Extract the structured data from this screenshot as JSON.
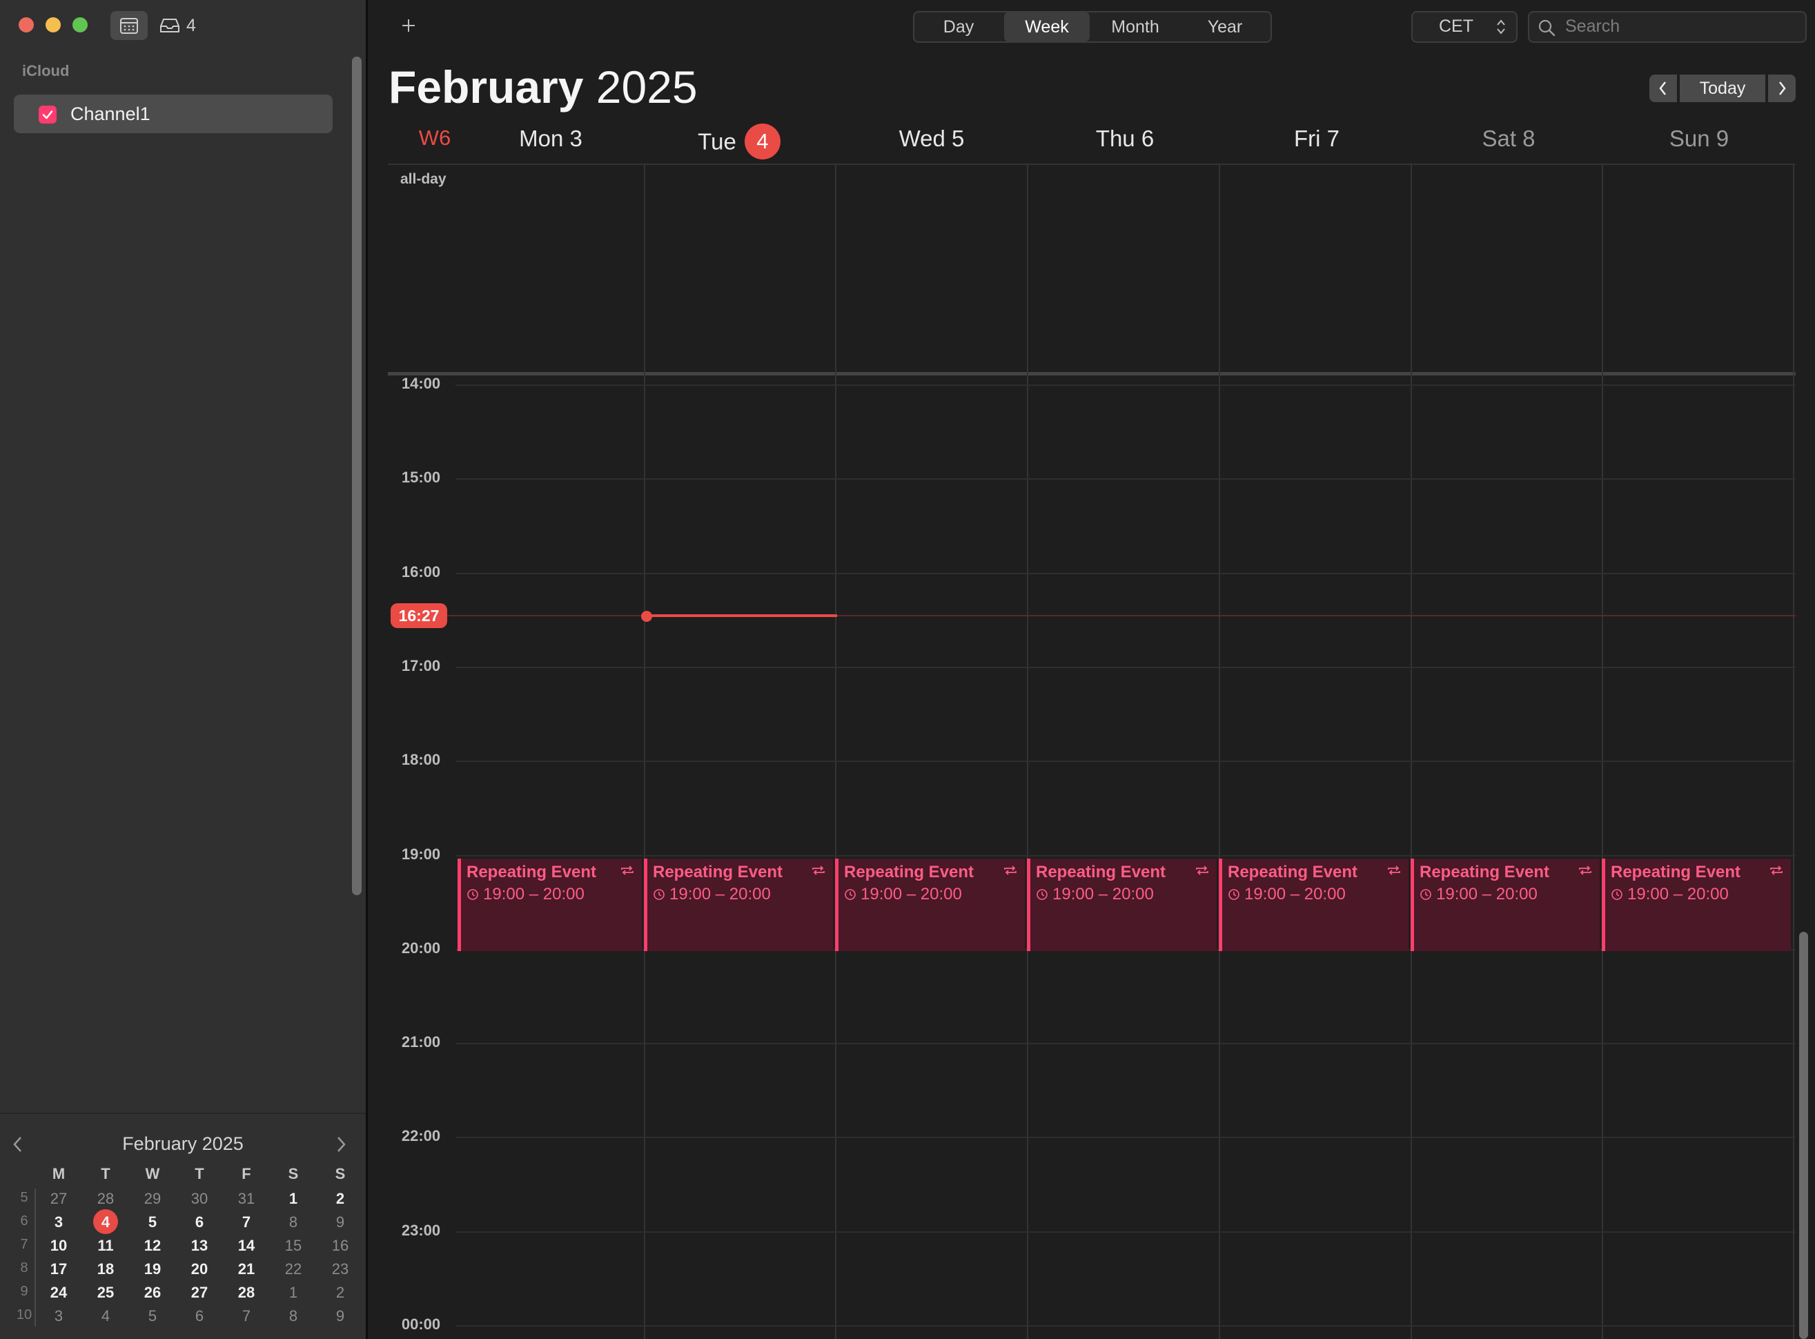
{
  "toolbar": {
    "inbox_count": "4",
    "views": [
      "Day",
      "Week",
      "Month",
      "Year"
    ],
    "active_view": "Week",
    "timezone": "CET",
    "search_placeholder": "Search",
    "today_label": "Today"
  },
  "sidebar": {
    "section_label": "iCloud",
    "calendars": [
      {
        "label": "Channel1",
        "checked": true,
        "color": "#ff3b6f"
      }
    ]
  },
  "header": {
    "month": "February",
    "year": "2025",
    "week_label": "W6"
  },
  "days": [
    {
      "label": "Mon 3"
    },
    {
      "label": "Tue",
      "num": "4",
      "today": true
    },
    {
      "label": "Wed 5"
    },
    {
      "label": "Thu 6"
    },
    {
      "label": "Fri 7"
    },
    {
      "label": "Sat 8",
      "weekend": true
    },
    {
      "label": "Sun 9",
      "weekend": true
    }
  ],
  "allday_label": "all-day",
  "times": [
    "14:00",
    "15:00",
    "16:00",
    "17:00",
    "18:00",
    "19:00",
    "20:00",
    "21:00",
    "22:00",
    "23:00",
    "00:00"
  ],
  "current_time": "16:27",
  "events": [
    {
      "title": "Repeating Event",
      "time": "19:00 – 20:00"
    },
    {
      "title": "Repeating Event",
      "time": "19:00 – 20:00"
    },
    {
      "title": "Repeating Event",
      "time": "19:00 – 20:00"
    },
    {
      "title": "Repeating Event",
      "time": "19:00 – 20:00"
    },
    {
      "title": "Repeating Event",
      "time": "19:00 – 20:00"
    },
    {
      "title": "Repeating Event",
      "time": "19:00 – 20:00"
    },
    {
      "title": "Repeating Event",
      "time": "19:00 – 20:00"
    }
  ],
  "mini_calendar": {
    "title": "February 2025",
    "weekday_headers": [
      "M",
      "T",
      "W",
      "T",
      "F",
      "S",
      "S"
    ],
    "weeks": [
      {
        "wk": "5",
        "days": [
          {
            "d": "27",
            "dim": true
          },
          {
            "d": "28",
            "dim": true
          },
          {
            "d": "29",
            "dim": true
          },
          {
            "d": "30",
            "dim": true
          },
          {
            "d": "31",
            "dim": true
          },
          {
            "d": "1"
          },
          {
            "d": "2"
          }
        ]
      },
      {
        "wk": "6",
        "days": [
          {
            "d": "3"
          },
          {
            "d": "4",
            "today": true
          },
          {
            "d": "5"
          },
          {
            "d": "6"
          },
          {
            "d": "7"
          },
          {
            "d": "8",
            "dim": true
          },
          {
            "d": "9",
            "dim": true
          }
        ]
      },
      {
        "wk": "7",
        "days": [
          {
            "d": "10"
          },
          {
            "d": "11"
          },
          {
            "d": "12"
          },
          {
            "d": "13"
          },
          {
            "d": "14"
          },
          {
            "d": "15",
            "dim": true
          },
          {
            "d": "16",
            "dim": true
          }
        ]
      },
      {
        "wk": "8",
        "days": [
          {
            "d": "17"
          },
          {
            "d": "18"
          },
          {
            "d": "19"
          },
          {
            "d": "20"
          },
          {
            "d": "21"
          },
          {
            "d": "22",
            "dim": true
          },
          {
            "d": "23",
            "dim": true
          }
        ]
      },
      {
        "wk": "9",
        "days": [
          {
            "d": "24"
          },
          {
            "d": "25"
          },
          {
            "d": "26"
          },
          {
            "d": "27"
          },
          {
            "d": "28"
          },
          {
            "d": "1",
            "dim": true
          },
          {
            "d": "2",
            "dim": true
          }
        ]
      },
      {
        "wk": "10",
        "days": [
          {
            "d": "3",
            "dim": true
          },
          {
            "d": "4",
            "dim": true
          },
          {
            "d": "5",
            "dim": true
          },
          {
            "d": "6",
            "dim": true
          },
          {
            "d": "7",
            "dim": true
          },
          {
            "d": "8",
            "dim": true
          },
          {
            "d": "9",
            "dim": true
          }
        ]
      }
    ]
  },
  "colors": {
    "accent": "#ea4b45",
    "event": "#ff3e6c",
    "event_bg": "#4a1827"
  }
}
